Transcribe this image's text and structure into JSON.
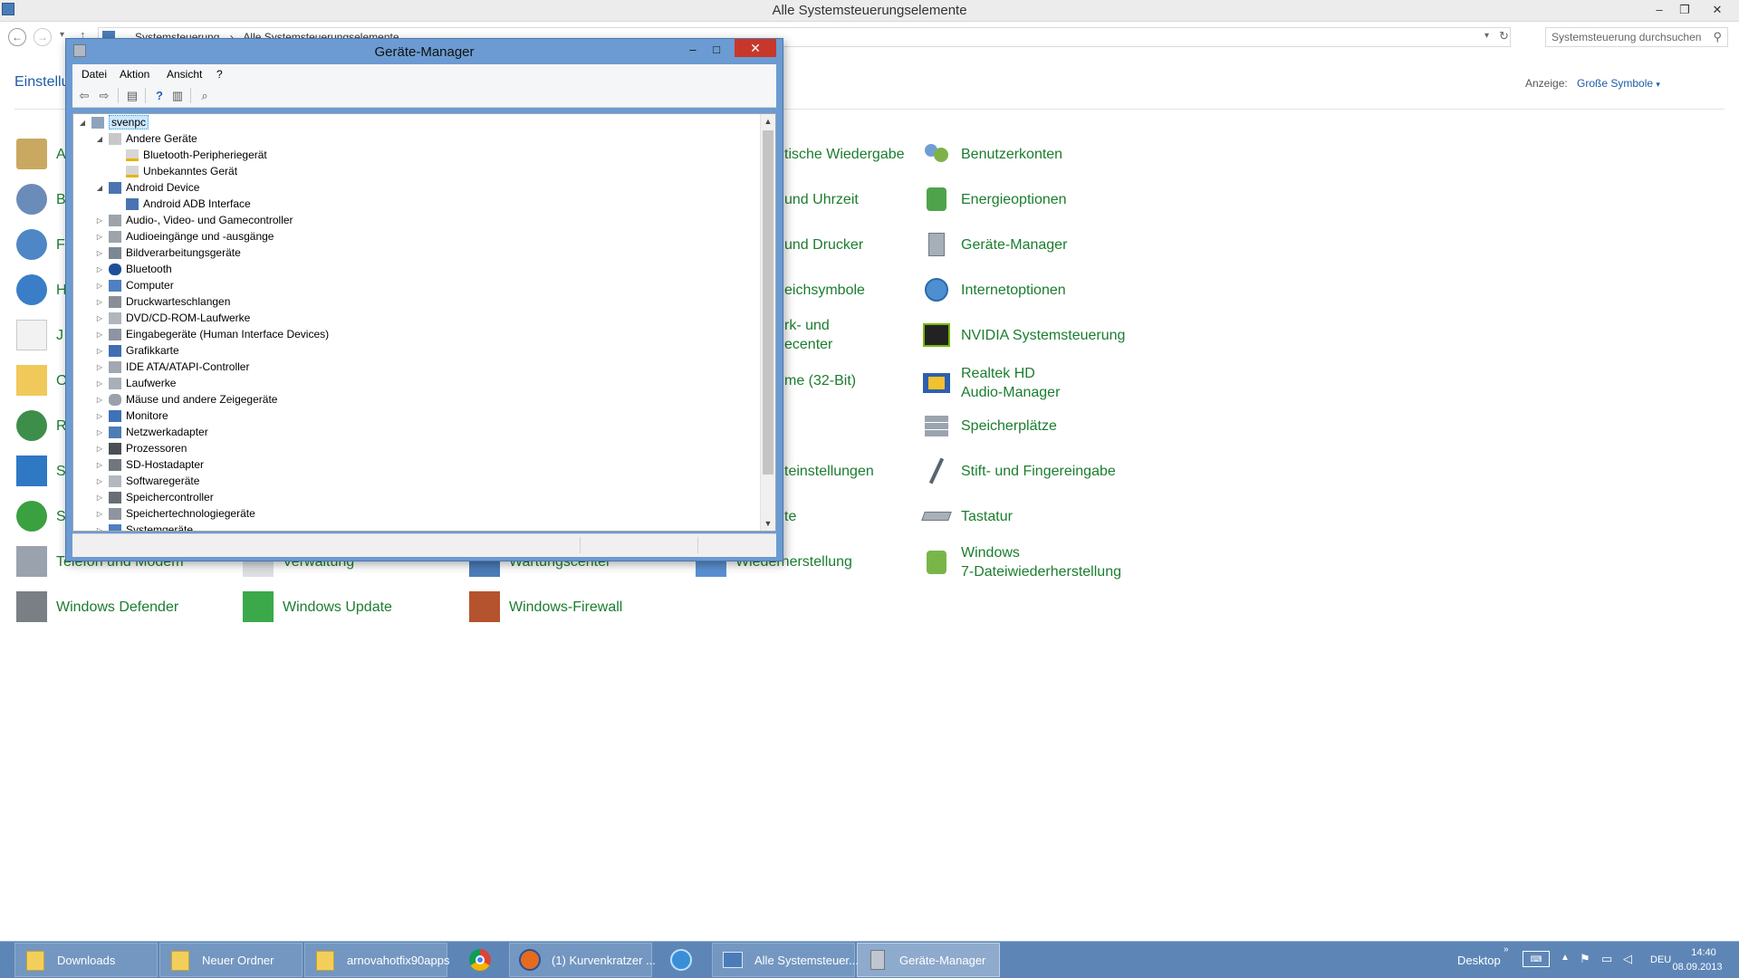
{
  "control_panel": {
    "window_title": "Alle Systemsteuerungselemente",
    "breadcrumb": [
      "Systemsteuerung",
      "Alle Systemsteuerungselemente"
    ],
    "search_placeholder": "Systemsteuerung durchsuchen",
    "heading": "Einstellu",
    "view_by_label": "Anzeige:",
    "view_by_value": "Große Symbole",
    "items": {
      "col0_r0": "A",
      "col0_r1": "B",
      "col0_r2": "F",
      "col0_r3": "H",
      "col0_r4": "J",
      "col0_r5": "O",
      "col0_r6": "R",
      "col0_r7": "S",
      "col0_r8": "S",
      "telefon": "Telefon und Modem",
      "defender": "Windows Defender",
      "verwaltung": "Verwaltung",
      "update": "Windows Update",
      "wartung": "Wartungscenter",
      "firewall": "Windows-Firewall",
      "wiederherstellung": "Wiederherstellung",
      "col3_r0": "tische Wiedergabe",
      "col3_r1": "und Uhrzeit",
      "col3_r2": "und Drucker",
      "col3_r3": "eichsymbole",
      "col3_r4a": "rk- und",
      "col3_r4b": "ecenter",
      "col3_r5": "me (32-Bit)",
      "col3_r7": "teinstellungen",
      "col3_r8": "te",
      "benutzerkonten": "Benutzerkonten",
      "energieoptionen": "Energieoptionen",
      "geraete_manager": "Geräte-Manager",
      "internetoptionen": "Internetoptionen",
      "nvidia": "NVIDIA Systemsteuerung",
      "realtek_1": "Realtek HD",
      "realtek_2": "Audio-Manager",
      "speicherplaetze": "Speicherplätze",
      "stift": "Stift- und Fingereingabe",
      "tastatur": "Tastatur",
      "win7_1": "Windows",
      "win7_2": "7-Dateiwiederherstellung"
    }
  },
  "device_manager": {
    "title": "Geräte-Manager",
    "menu": [
      "Datei",
      "Aktion",
      "Ansicht",
      "?"
    ],
    "tree": [
      {
        "label": "svenpc",
        "expanded": true
      },
      {
        "label": "Andere Geräte",
        "expanded": true
      },
      {
        "label": "Bluetooth-Peripheriegerät"
      },
      {
        "label": "Unbekanntes Gerät"
      },
      {
        "label": "Android Device",
        "expanded": true
      },
      {
        "label": "Android ADB Interface"
      },
      {
        "label": "Audio-, Video- und Gamecontroller"
      },
      {
        "label": "Audioeingänge und -ausgänge"
      },
      {
        "label": "Bildverarbeitungsgeräte"
      },
      {
        "label": "Bluetooth"
      },
      {
        "label": "Computer"
      },
      {
        "label": "Druckwarteschlangen"
      },
      {
        "label": "DVD/CD-ROM-Laufwerke"
      },
      {
        "label": "Eingabegeräte (Human Interface Devices)"
      },
      {
        "label": "Grafikkarte"
      },
      {
        "label": "IDE ATA/ATAPI-Controller"
      },
      {
        "label": "Laufwerke"
      },
      {
        "label": "Mäuse und andere Zeigegeräte"
      },
      {
        "label": "Monitore"
      },
      {
        "label": "Netzwerkadapter"
      },
      {
        "label": "Prozessoren"
      },
      {
        "label": "SD-Hostadapter"
      },
      {
        "label": "Softwaregeräte"
      },
      {
        "label": "Speichercontroller"
      },
      {
        "label": "Speichertechnologiegeräte"
      },
      {
        "label": "Systemgeräte"
      }
    ]
  },
  "taskbar": {
    "buttons": [
      "Downloads",
      "Neuer Ordner",
      "arnovahotfix90apps",
      "",
      "(1) Kurvenkratzer ...",
      "",
      "Alle Systemsteuer...",
      "Geräte-Manager"
    ],
    "desktop_label": "Desktop",
    "language": "DEU",
    "time": "14:40",
    "date": "08.09.2013"
  },
  "colors": {
    "link_green": "#1b7d2e",
    "heading_blue": "#1e5ca6",
    "taskbar": "#5d86b7",
    "dm_frame": "#6b9bd2",
    "close_red": "#c7382b"
  },
  "icons": {
    "nav": [
      "back-icon",
      "forward-icon",
      "up-icon",
      "refresh-icon",
      "search-icon"
    ],
    "toolbar": [
      "back-icon",
      "forward-icon",
      "properties-icon",
      "help-icon",
      "view-icon",
      "scan-hardware-icon"
    ]
  }
}
